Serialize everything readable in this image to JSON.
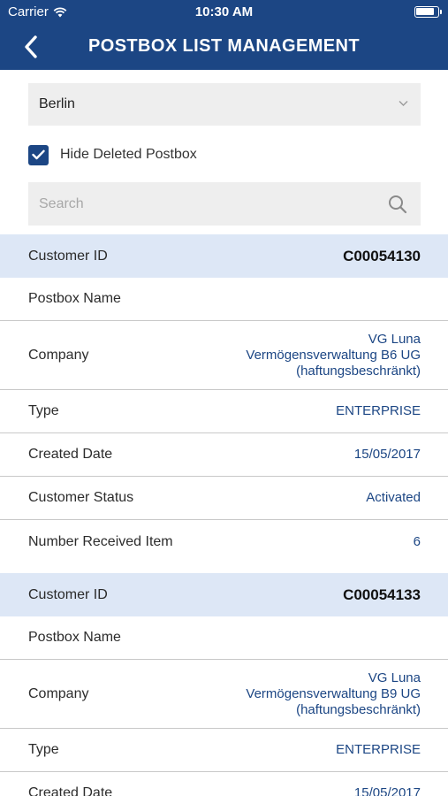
{
  "status_bar": {
    "carrier": "Carrier",
    "time": "10:30 AM",
    "wifi_icon": "wifi-icon",
    "battery_icon": "battery-icon"
  },
  "nav": {
    "title": "POSTBOX LIST MANAGEMENT",
    "back_icon": "chevron-left-icon"
  },
  "filters": {
    "location": "Berlin",
    "hide_deleted_label": "Hide Deleted Postbox",
    "hide_deleted_checked": true,
    "search_placeholder": "Search",
    "search_value": ""
  },
  "labels": {
    "customer_id": "Customer ID",
    "postbox_name": "Postbox Name",
    "company": "Company",
    "type": "Type",
    "created_date": "Created Date",
    "customer_status": "Customer Status",
    "number_received_item": "Number Received Item"
  },
  "customers": [
    {
      "customer_id": "C00054130",
      "postbox_name": "",
      "company": [
        "VG Luna",
        "Vermögensverwaltung B6 UG",
        "(haftungsbeschränkt)"
      ],
      "type": "ENTERPRISE",
      "created_date": "15/05/2017",
      "customer_status": "Activated",
      "number_received_item": "6"
    },
    {
      "customer_id": "C00054133",
      "postbox_name": "",
      "company": [
        "VG Luna",
        "Vermögensverwaltung B9 UG",
        "(haftungsbeschränkt)"
      ],
      "type": "ENTERPRISE",
      "created_date": "15/05/2017"
    }
  ],
  "colors": {
    "nav_background": "#1c4684",
    "header_row_background": "#dde7f6",
    "value_text": "#1c4684"
  }
}
